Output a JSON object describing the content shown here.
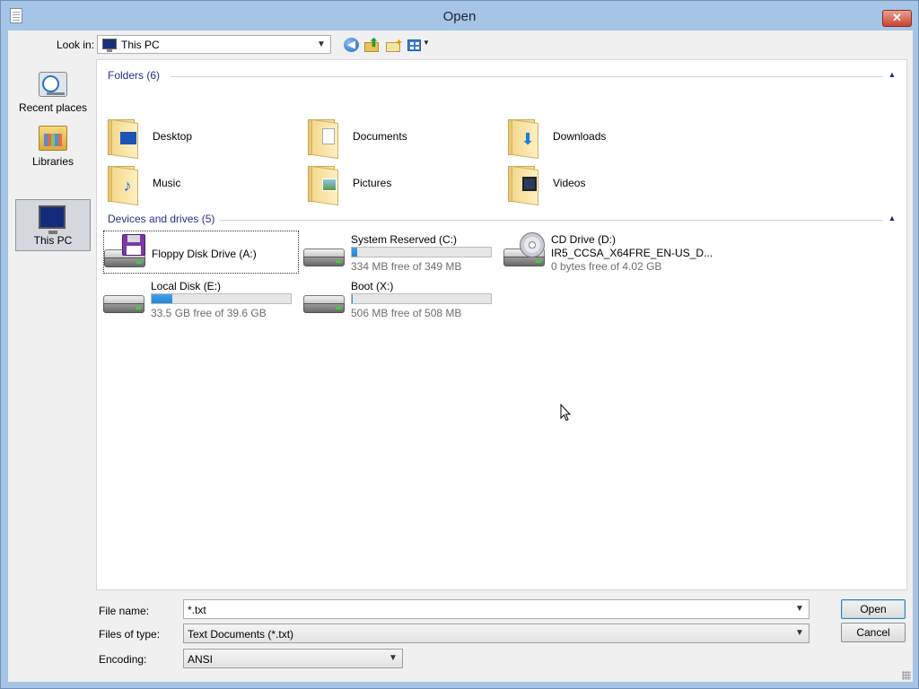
{
  "window": {
    "title": "Open"
  },
  "lookin": {
    "label": "Look in:",
    "value": "This PC"
  },
  "places": [
    {
      "label": "Recent places",
      "icon": "recent-places-icon",
      "selected": false
    },
    {
      "label": "Libraries",
      "icon": "libraries-icon",
      "selected": false
    },
    {
      "label": "This PC",
      "icon": "this-pc-icon",
      "selected": true
    }
  ],
  "folders": {
    "header": "Folders (6)",
    "items": [
      {
        "label": "Desktop",
        "icon": "desktop-folder-icon"
      },
      {
        "label": "Documents",
        "icon": "documents-folder-icon"
      },
      {
        "label": "Downloads",
        "icon": "downloads-folder-icon"
      },
      {
        "label": "Music",
        "icon": "music-folder-icon"
      },
      {
        "label": "Pictures",
        "icon": "pictures-folder-icon"
      },
      {
        "label": "Videos",
        "icon": "videos-folder-icon"
      }
    ]
  },
  "drives": {
    "header": "Devices and drives (5)",
    "items": [
      {
        "name": "Floppy Disk Drive (A:)",
        "icon": "floppy-drive-icon"
      },
      {
        "name": "System Reserved (C:)",
        "free": "334 MB free of 349 MB",
        "used_fraction": 0.04,
        "icon": "hard-drive-icon"
      },
      {
        "name": "CD Drive (D:)",
        "sub": "IR5_CCSA_X64FRE_EN-US_D...",
        "free": "0 bytes free of 4.02 GB",
        "icon": "cd-drive-icon"
      },
      {
        "name": "Local Disk (E:)",
        "free": "33.5 GB free of 39.6 GB",
        "used_fraction": 0.15,
        "icon": "hard-drive-icon"
      },
      {
        "name": "Boot (X:)",
        "free": "506 MB free of 508 MB",
        "used_fraction": 0.004,
        "icon": "hard-drive-icon"
      }
    ]
  },
  "bottom": {
    "filename_label": "File name:",
    "filename_value": "*.txt",
    "filetype_label": "Files of type:",
    "filetype_value": "Text Documents (*.txt)",
    "encoding_label": "Encoding:",
    "encoding_value": "ANSI",
    "open_label": "Open",
    "cancel_label": "Cancel"
  },
  "colors": {
    "accent": "#1e3287",
    "drive_bar": "#2685d3",
    "titlebar": "#a6c4e6",
    "close": "#c7432f"
  }
}
